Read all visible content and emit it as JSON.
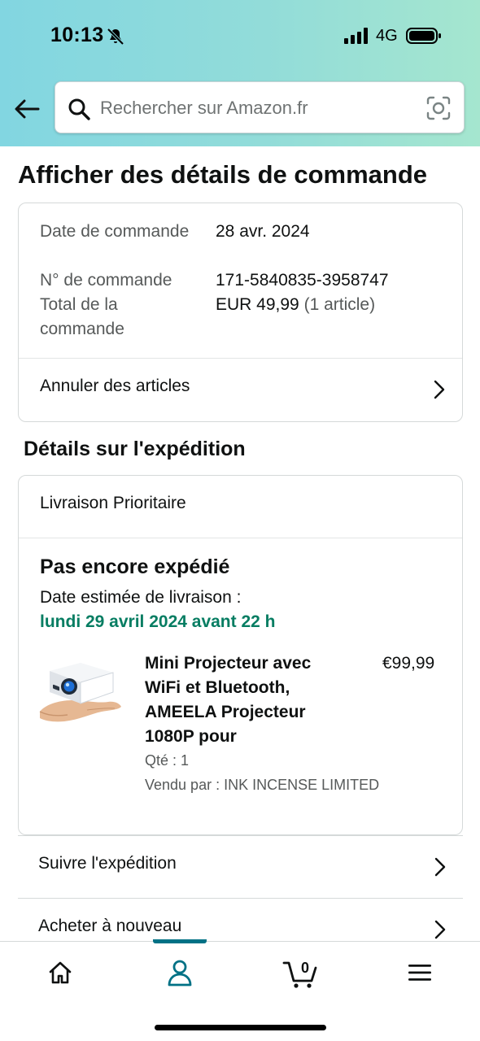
{
  "status_bar": {
    "time": "10:13",
    "network": "4G"
  },
  "search": {
    "placeholder": "Rechercher sur Amazon.fr"
  },
  "page": {
    "title": "Afficher des détails de commande"
  },
  "order_summary": {
    "date_label": "Date de commande",
    "date_value": "28 avr. 2024",
    "number_label": "N° de commande",
    "number_value": "171-5840835-3958747",
    "total_label": "Total de la commande",
    "total_value": "EUR 49,99",
    "total_items": "(1 article)",
    "cancel_label": "Annuler des articles"
  },
  "shipment": {
    "section_title": "Détails sur l'expédition",
    "method": "Livraison Prioritaire",
    "status": "Pas encore expédié",
    "estimate_label": "Date estimée de livraison :",
    "estimate_date": "lundi 29 avril 2024 avant 22 h",
    "product": {
      "title": "Mini Projecteur avec WiFi et Bluetooth, AMEELA Projecteur 1080P pour",
      "price": "€99,99",
      "qty": "Qté : 1",
      "seller": "Vendu par : INK INCENSE LIMITED"
    }
  },
  "actions": {
    "track_label": "Suivre l'expédition",
    "buy_again_label": "Acheter à nouveau"
  },
  "tabbar": {
    "cart_count": "0",
    "active_tab": "profile"
  },
  "colors": {
    "accent": "#007185",
    "delivery_green": "#067d62"
  }
}
